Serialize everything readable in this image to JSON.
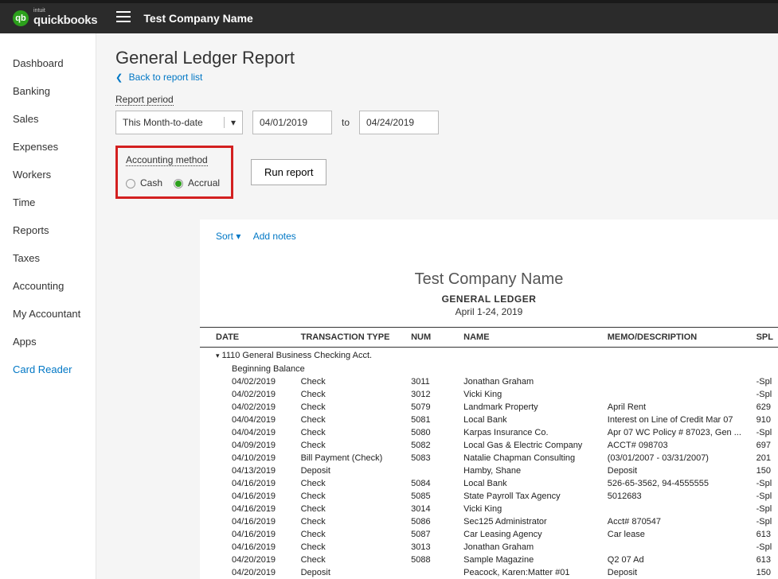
{
  "topbar": {
    "brandPrefix": "intuit",
    "brand": "quickbooks",
    "company": "Test Company Name"
  },
  "sidebar": {
    "items": [
      "Dashboard",
      "Banking",
      "Sales",
      "Expenses",
      "Workers",
      "Time",
      "Reports",
      "Taxes",
      "Accounting",
      "My Accountant",
      "Apps",
      "Card Reader"
    ],
    "activeIndex": 11
  },
  "page": {
    "title": "General Ledger Report",
    "backLink": "Back to report list",
    "periodLabel": "Report period",
    "periodSelect": "This Month-to-date",
    "dateFrom": "04/01/2019",
    "toLabel": "to",
    "dateTo": "04/24/2019",
    "methodLabel": "Accounting method",
    "methodCash": "Cash",
    "methodAccrual": "Accrual",
    "methodSelected": "Accrual",
    "runButton": "Run report",
    "sortLabel": "Sort",
    "addNotesLabel": "Add notes"
  },
  "report": {
    "company": "Test Company Name",
    "reportTitle": "GENERAL LEDGER",
    "dateRange": "April 1-24, 2019",
    "columns": [
      "DATE",
      "TRANSACTION TYPE",
      "NUM",
      "NAME",
      "MEMO/DESCRIPTION",
      "SPL"
    ],
    "accountLine": "1110 General Business Checking Acct.",
    "beginningBalance": "Beginning Balance",
    "rows": [
      {
        "date": "04/02/2019",
        "type": "Check",
        "num": "3011",
        "name": "Jonathan Graham",
        "memo": "",
        "split": "-Spl"
      },
      {
        "date": "04/02/2019",
        "type": "Check",
        "num": "3012",
        "name": "Vicki King",
        "memo": "",
        "split": "-Spl"
      },
      {
        "date": "04/02/2019",
        "type": "Check",
        "num": "5079",
        "name": "Landmark Property",
        "memo": "April Rent",
        "split": "629"
      },
      {
        "date": "04/04/2019",
        "type": "Check",
        "num": "5081",
        "name": "Local Bank",
        "memo": "Interest on Line of Credit Mar 07",
        "split": "910"
      },
      {
        "date": "04/04/2019",
        "type": "Check",
        "num": "5080",
        "name": "Karpas Insurance Co.",
        "memo": "Apr 07 WC Policy # 87023, Gen ...",
        "split": "-Spl"
      },
      {
        "date": "04/09/2019",
        "type": "Check",
        "num": "5082",
        "name": "Local Gas & Electric Company",
        "memo": "ACCT# 098703",
        "split": "697"
      },
      {
        "date": "04/10/2019",
        "type": "Bill Payment (Check)",
        "num": "5083",
        "name": "Natalie Chapman Consulting",
        "memo": "(03/01/2007 - 03/31/2007)",
        "split": "201"
      },
      {
        "date": "04/13/2019",
        "type": "Deposit",
        "num": "",
        "name": "Hamby, Shane",
        "memo": "Deposit",
        "split": "150"
      },
      {
        "date": "04/16/2019",
        "type": "Check",
        "num": "5084",
        "name": "Local Bank",
        "memo": "526-65-3562, 94-4555555",
        "split": "-Spl"
      },
      {
        "date": "04/16/2019",
        "type": "Check",
        "num": "5085",
        "name": "State Payroll Tax Agency",
        "memo": "5012683",
        "split": "-Spl"
      },
      {
        "date": "04/16/2019",
        "type": "Check",
        "num": "3014",
        "name": "Vicki King",
        "memo": "",
        "split": "-Spl"
      },
      {
        "date": "04/16/2019",
        "type": "Check",
        "num": "5086",
        "name": "Sec125 Administrator",
        "memo": "Acct# 870547",
        "split": "-Spl"
      },
      {
        "date": "04/16/2019",
        "type": "Check",
        "num": "5087",
        "name": "Car Leasing Agency",
        "memo": "Car lease",
        "split": "613"
      },
      {
        "date": "04/16/2019",
        "type": "Check",
        "num": "3013",
        "name": "Jonathan Graham",
        "memo": "",
        "split": "-Spl"
      },
      {
        "date": "04/20/2019",
        "type": "Check",
        "num": "5088",
        "name": "Sample Magazine",
        "memo": "Q2 07 Ad",
        "split": "613"
      },
      {
        "date": "04/20/2019",
        "type": "Deposit",
        "num": "",
        "name": "Peacock, Karen:Matter #01",
        "memo": "Deposit",
        "split": "150"
      }
    ]
  }
}
